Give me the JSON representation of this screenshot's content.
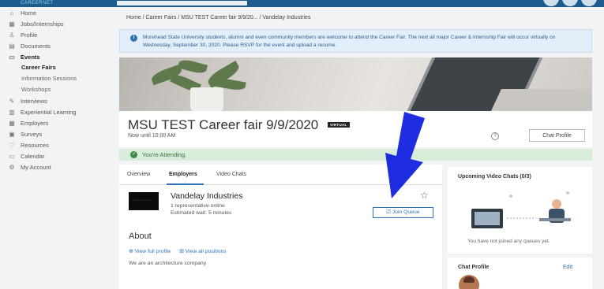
{
  "topbar": {
    "brand": "CAREERNET"
  },
  "sidebar": {
    "items": [
      {
        "label": "Home",
        "icon": "home-icon",
        "glyph": "⌂"
      },
      {
        "label": "Jobs/Internships",
        "icon": "briefcase-icon",
        "glyph": "▦"
      },
      {
        "label": "Profile",
        "icon": "user-icon",
        "glyph": "♙"
      },
      {
        "label": "Documents",
        "icon": "document-icon",
        "glyph": "▤"
      },
      {
        "label": "Events",
        "icon": "calendar-icon",
        "glyph": "▭"
      },
      {
        "label": "Interviews",
        "icon": "handshake-icon",
        "glyph": "✎"
      },
      {
        "label": "Experiential Learning",
        "icon": "building-icon",
        "glyph": "▥"
      },
      {
        "label": "Employers",
        "icon": "employers-icon",
        "glyph": "▦"
      },
      {
        "label": "Surveys",
        "icon": "survey-icon",
        "glyph": "▣"
      },
      {
        "label": "Resources",
        "icon": "resources-icon",
        "glyph": "♡"
      },
      {
        "label": "Calendar",
        "icon": "calendar-month-icon",
        "glyph": "▭"
      },
      {
        "label": "My Account",
        "icon": "gear-icon",
        "glyph": "⚙"
      }
    ],
    "event_sub": [
      "Career Fairs",
      "Information Sessions",
      "Workshops"
    ]
  },
  "breadcrumb": "Home / Career Fairs / MSU TEST Career fair 9/9/20... / Vandelay Industries",
  "alert": {
    "text": "Morehead State University students, alumni and even community members are welcome to attend the Career Fair. The next all major Career & Internship Fair will occur virtually on Wednesday, September 30, 2020.  Please RSVP for the event and upload a resume."
  },
  "event": {
    "title": "MSU TEST Career fair 9/9/2020",
    "badge": "VIRTUAL",
    "subtitle": "Now until 10:00 AM",
    "chat_profile_btn": "Chat Profile",
    "attending": "You're Attending."
  },
  "tabs": [
    "Overview",
    "Employers",
    "Video Chats"
  ],
  "employer": {
    "name": "Vandelay Industries",
    "logo_text": "VANDELAY INDUSTRIES",
    "reps": "1 representative online",
    "wait": "Estimated wait: 5 minutes",
    "join_btn": "⎚ Join Queue"
  },
  "about": {
    "title": "About",
    "link_profile": "⊕ View full profile",
    "link_positions": "⊞ View all positions",
    "text": "We are an architecture company"
  },
  "upcoming": {
    "title": "Upcoming Video Chats (0/3)",
    "empty": "You have not joined any queues yet."
  },
  "chat_profile": {
    "title": "Chat Profile",
    "edit": "Edit"
  },
  "colors": {
    "accent": "#2e73b8",
    "arrow": "#1f2de0",
    "success_bg": "#d7ecd9",
    "topbar": "#1d5c8f"
  }
}
